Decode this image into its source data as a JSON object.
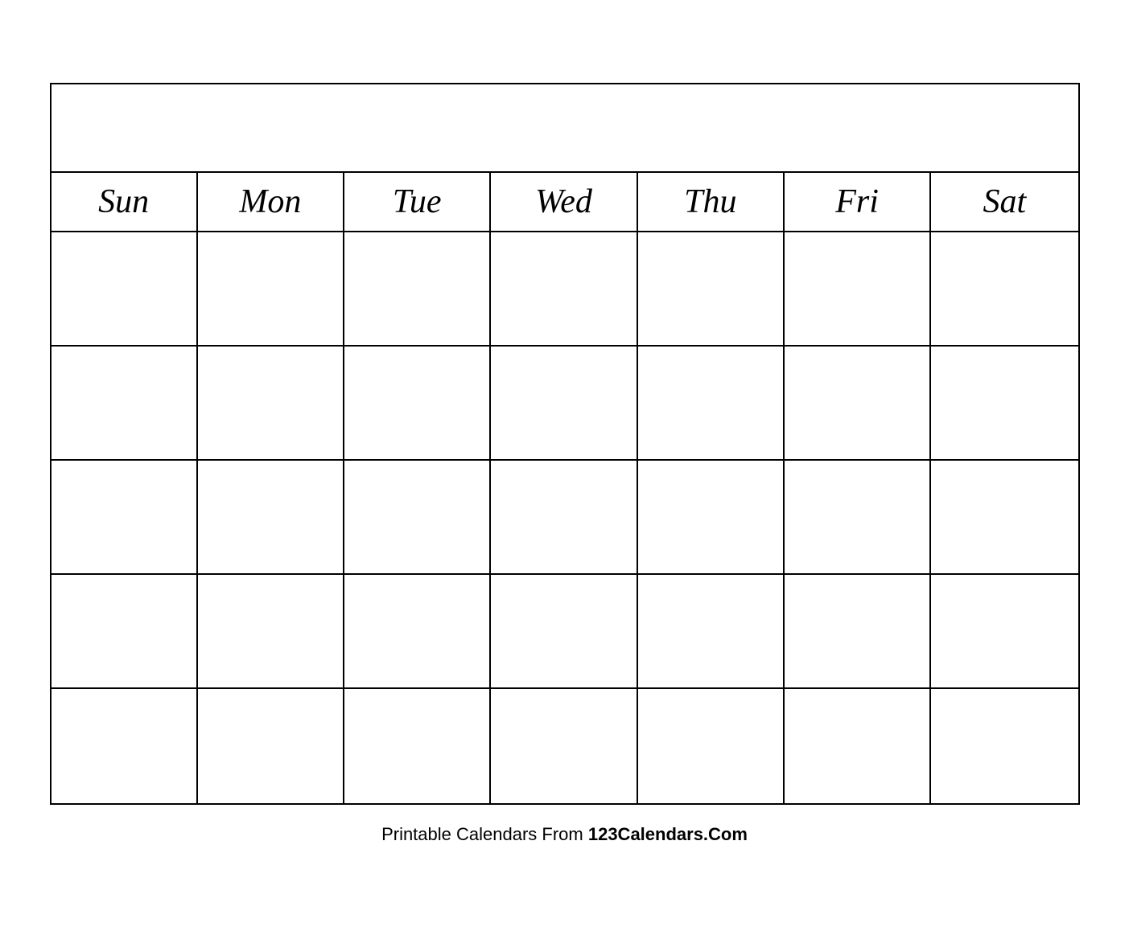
{
  "calendar": {
    "days": [
      {
        "label": "Sun"
      },
      {
        "label": "Mon"
      },
      {
        "label": "Tue"
      },
      {
        "label": "Wed"
      },
      {
        "label": "Thu"
      },
      {
        "label": "Fri"
      },
      {
        "label": "Sat"
      }
    ],
    "weeks": 5
  },
  "footer": {
    "text_plain": "Printable Calendars From ",
    "text_bold": "123Calendars.Com"
  }
}
